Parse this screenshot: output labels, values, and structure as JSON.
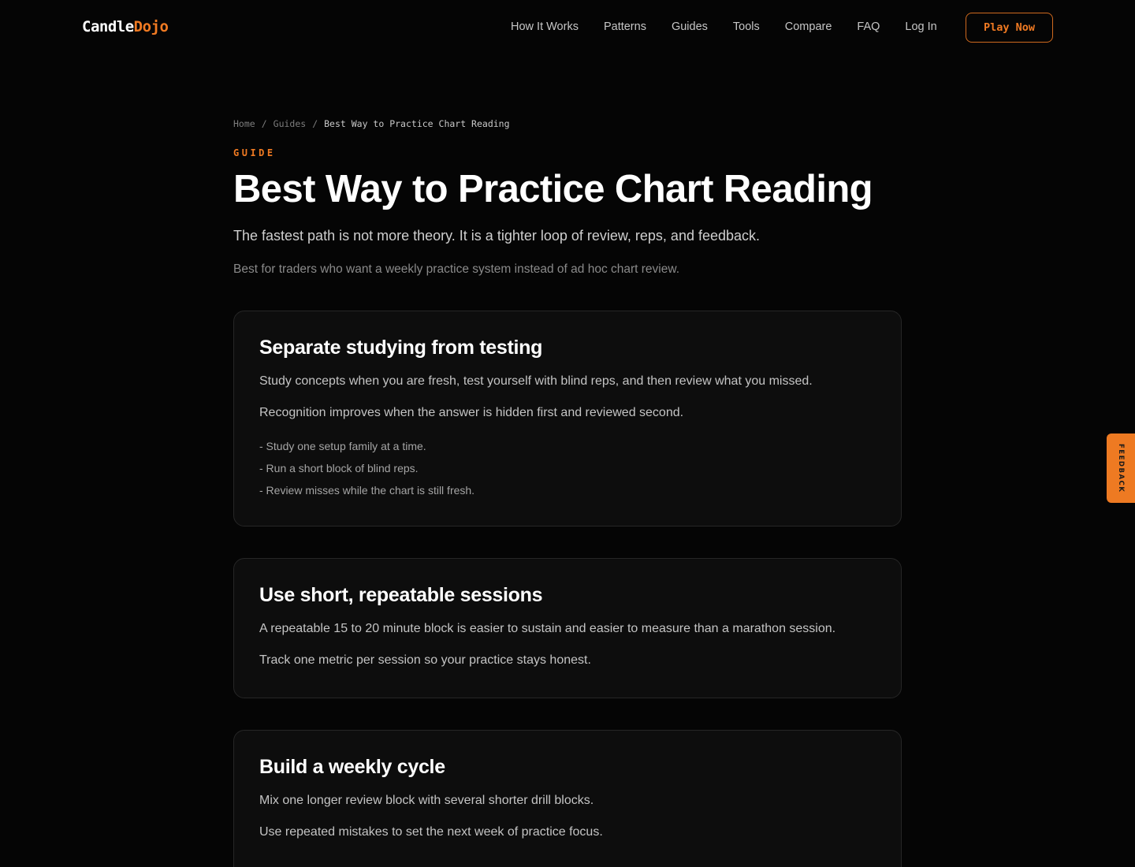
{
  "header": {
    "logo_part1": "Candle",
    "logo_part2": "Dojo",
    "nav": [
      "How It Works",
      "Patterns",
      "Guides",
      "Tools",
      "Compare",
      "FAQ",
      "Log In"
    ],
    "cta_label": "Play Now"
  },
  "breadcrumb": {
    "items": [
      "Home",
      "Guides"
    ],
    "separator": "/",
    "current": "Best Way to Practice Chart Reading"
  },
  "article": {
    "eyebrow": "GUIDE",
    "title": "Best Way to Practice Chart Reading",
    "subtitle": "The fastest path is not more theory. It is a tighter loop of review, reps, and feedback.",
    "audience": "Best for traders who want a weekly practice system instead of ad hoc chart review.",
    "sections": [
      {
        "heading": "Separate studying from testing",
        "paragraphs": [
          "Study concepts when you are fresh, test yourself with blind reps, and then review what you missed.",
          "Recognition improves when the answer is hidden first and reviewed second."
        ],
        "bullets": [
          "- Study one setup family at a time.",
          "- Run a short block of blind reps.",
          "- Review misses while the chart is still fresh."
        ]
      },
      {
        "heading": "Use short, repeatable sessions",
        "paragraphs": [
          "A repeatable 15 to 20 minute block is easier to sustain and easier to measure than a marathon session.",
          "Track one metric per session so your practice stays honest."
        ]
      },
      {
        "heading": "Build a weekly cycle",
        "paragraphs": [
          "Mix one longer review block with several shorter drill blocks.",
          "Use repeated mistakes to set the next week of practice focus."
        ]
      }
    ]
  },
  "feedback_tab": "FEEDBACK",
  "colors": {
    "background": "#050505",
    "accent": "#f07a22",
    "card": "#0d0d0d"
  }
}
